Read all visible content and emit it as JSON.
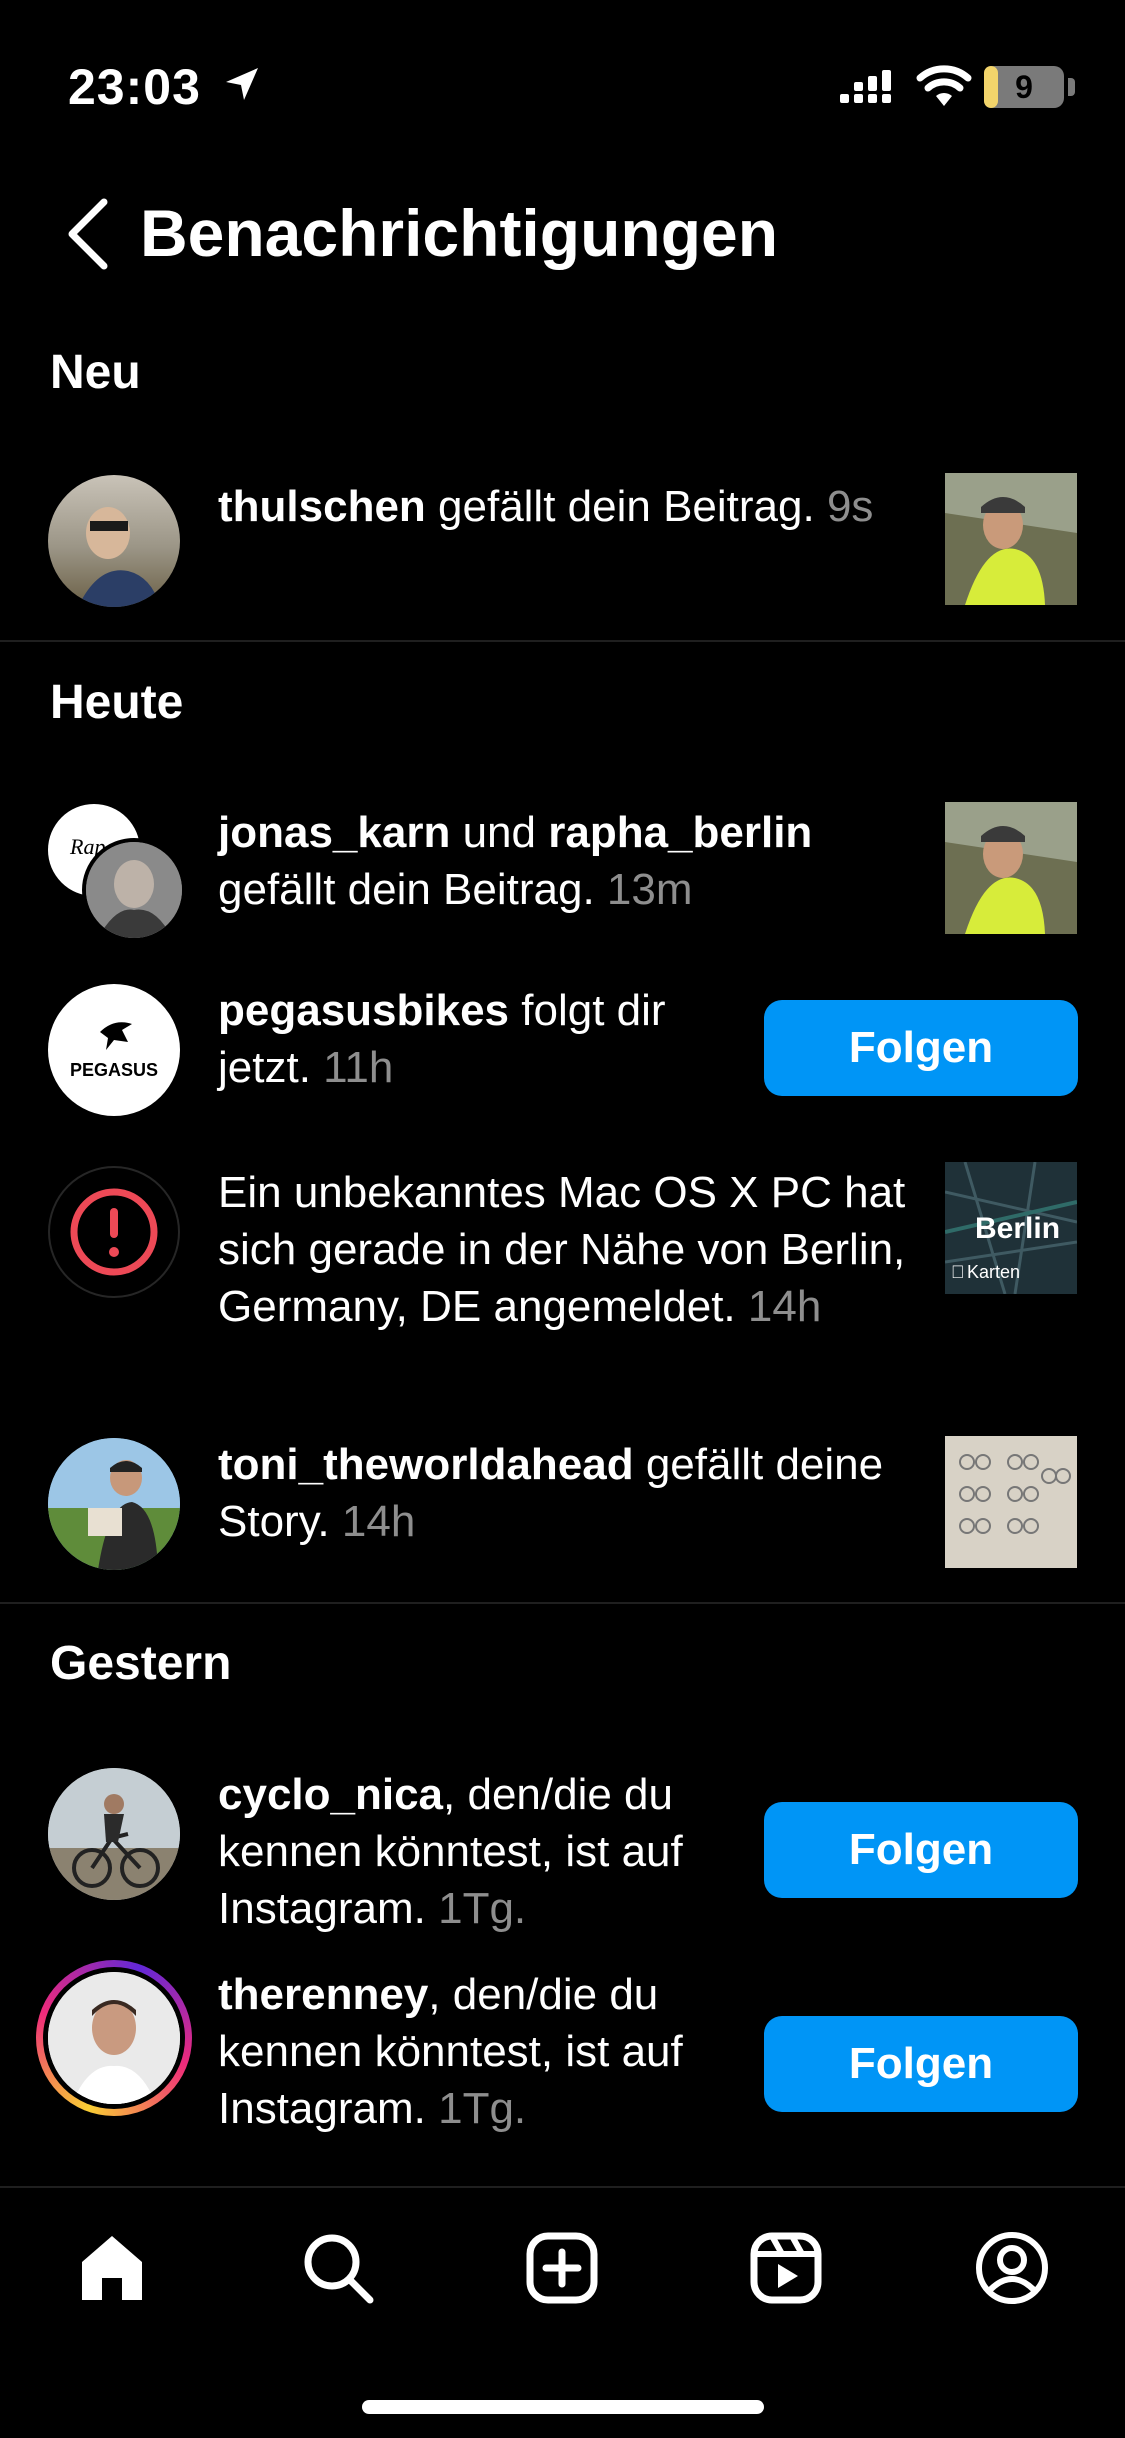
{
  "status": {
    "time": "23:03",
    "battery": "9",
    "battery_fraction": 0.09
  },
  "header": {
    "title": "Benachrichtigungen"
  },
  "sections": {
    "new": "Neu",
    "today": "Heute",
    "yesterday": "Gestern"
  },
  "notifications": [
    {
      "user": "thulschen",
      "text": " gefällt dein Beitrag. ",
      "time": "9s"
    },
    {
      "user": "jonas_karn",
      "mid": " und ",
      "user2": "rapha_berlin",
      "text": " gefällt dein Beitrag. ",
      "time": "13m"
    },
    {
      "user": "pegasusbikes",
      "text": " folgt dir jetzt. ",
      "time": "11h",
      "button": "Folgen",
      "avatar_text": "PEGASUS"
    },
    {
      "text": "Ein unbekanntes Mac OS X PC hat sich gerade in der Nähe von Berlin, Germany, DE angemeldet. ",
      "time": "14h",
      "map_city": "Berlin",
      "map_app": "Karten"
    },
    {
      "user": "toni_theworldahead",
      "text": " gefällt deine Story. ",
      "time": "14h"
    },
    {
      "user": "cyclo_nica",
      "text": ", den/die du kennen könntest, ist auf Instagram. ",
      "time": "1Tg.",
      "button": "Folgen"
    },
    {
      "user": "therenney",
      "text": ", den/die du kennen könntest, ist auf Instagram. ",
      "time": "1Tg.",
      "button": "Folgen"
    }
  ],
  "tabs": [
    "home",
    "search",
    "create",
    "reels",
    "profile"
  ]
}
